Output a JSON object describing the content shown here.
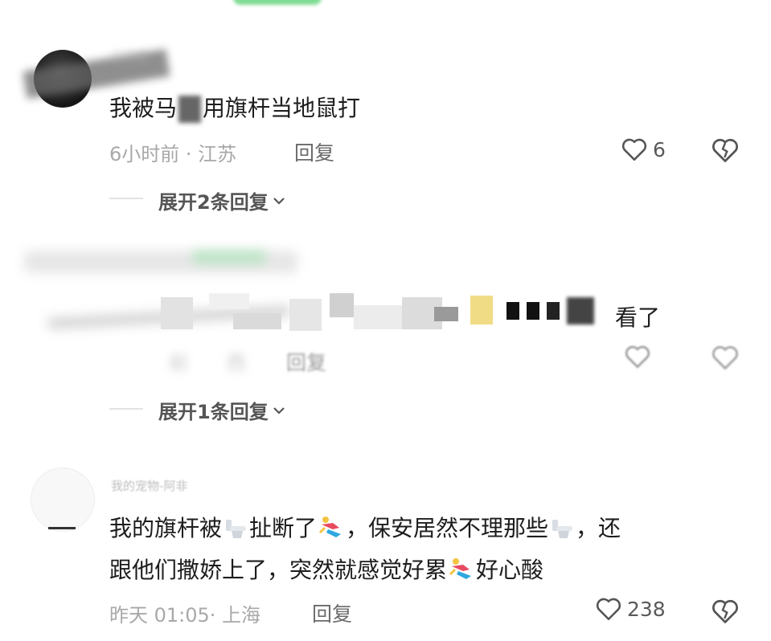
{
  "comments": [
    {
      "username": "汀子林",
      "content_pre": "我被马",
      "content_post": "用旗杆当地鼠打",
      "time": "6小时前",
      "location": "江苏",
      "reply_label": "回复",
      "likes": "6",
      "expand_label": "展开2条回复",
      "expand_icon": "chevron-down"
    },
    {
      "content": "看了",
      "meta_time": "前",
      "meta_location": "西",
      "reply_label": "回复",
      "expand_label": "展开1条回复",
      "expand_icon": "chevron-down"
    },
    {
      "username": "我的宠物-阿非",
      "line1_part1": "我的旗杆被",
      "line1_part2": "扯断了",
      "line1_part3": "，保安居然不理那些",
      "line1_part4": "，还",
      "line2_part1": "跟他们撒娇上了，突然就感觉好累",
      "line2_part2": "好心酸",
      "time": "昨天 01:05",
      "location": "上海",
      "reply_label": "回复",
      "likes": "238"
    }
  ],
  "icons": {
    "like": "heart-outline-icon",
    "dislike": "broken-heart-icon",
    "toilet": "toilet-emoji",
    "runner": "runner-emoji"
  },
  "colors": {
    "text": "#1d1d1d",
    "meta": "#a8a8a8",
    "green_banner": "#5fd07a"
  }
}
